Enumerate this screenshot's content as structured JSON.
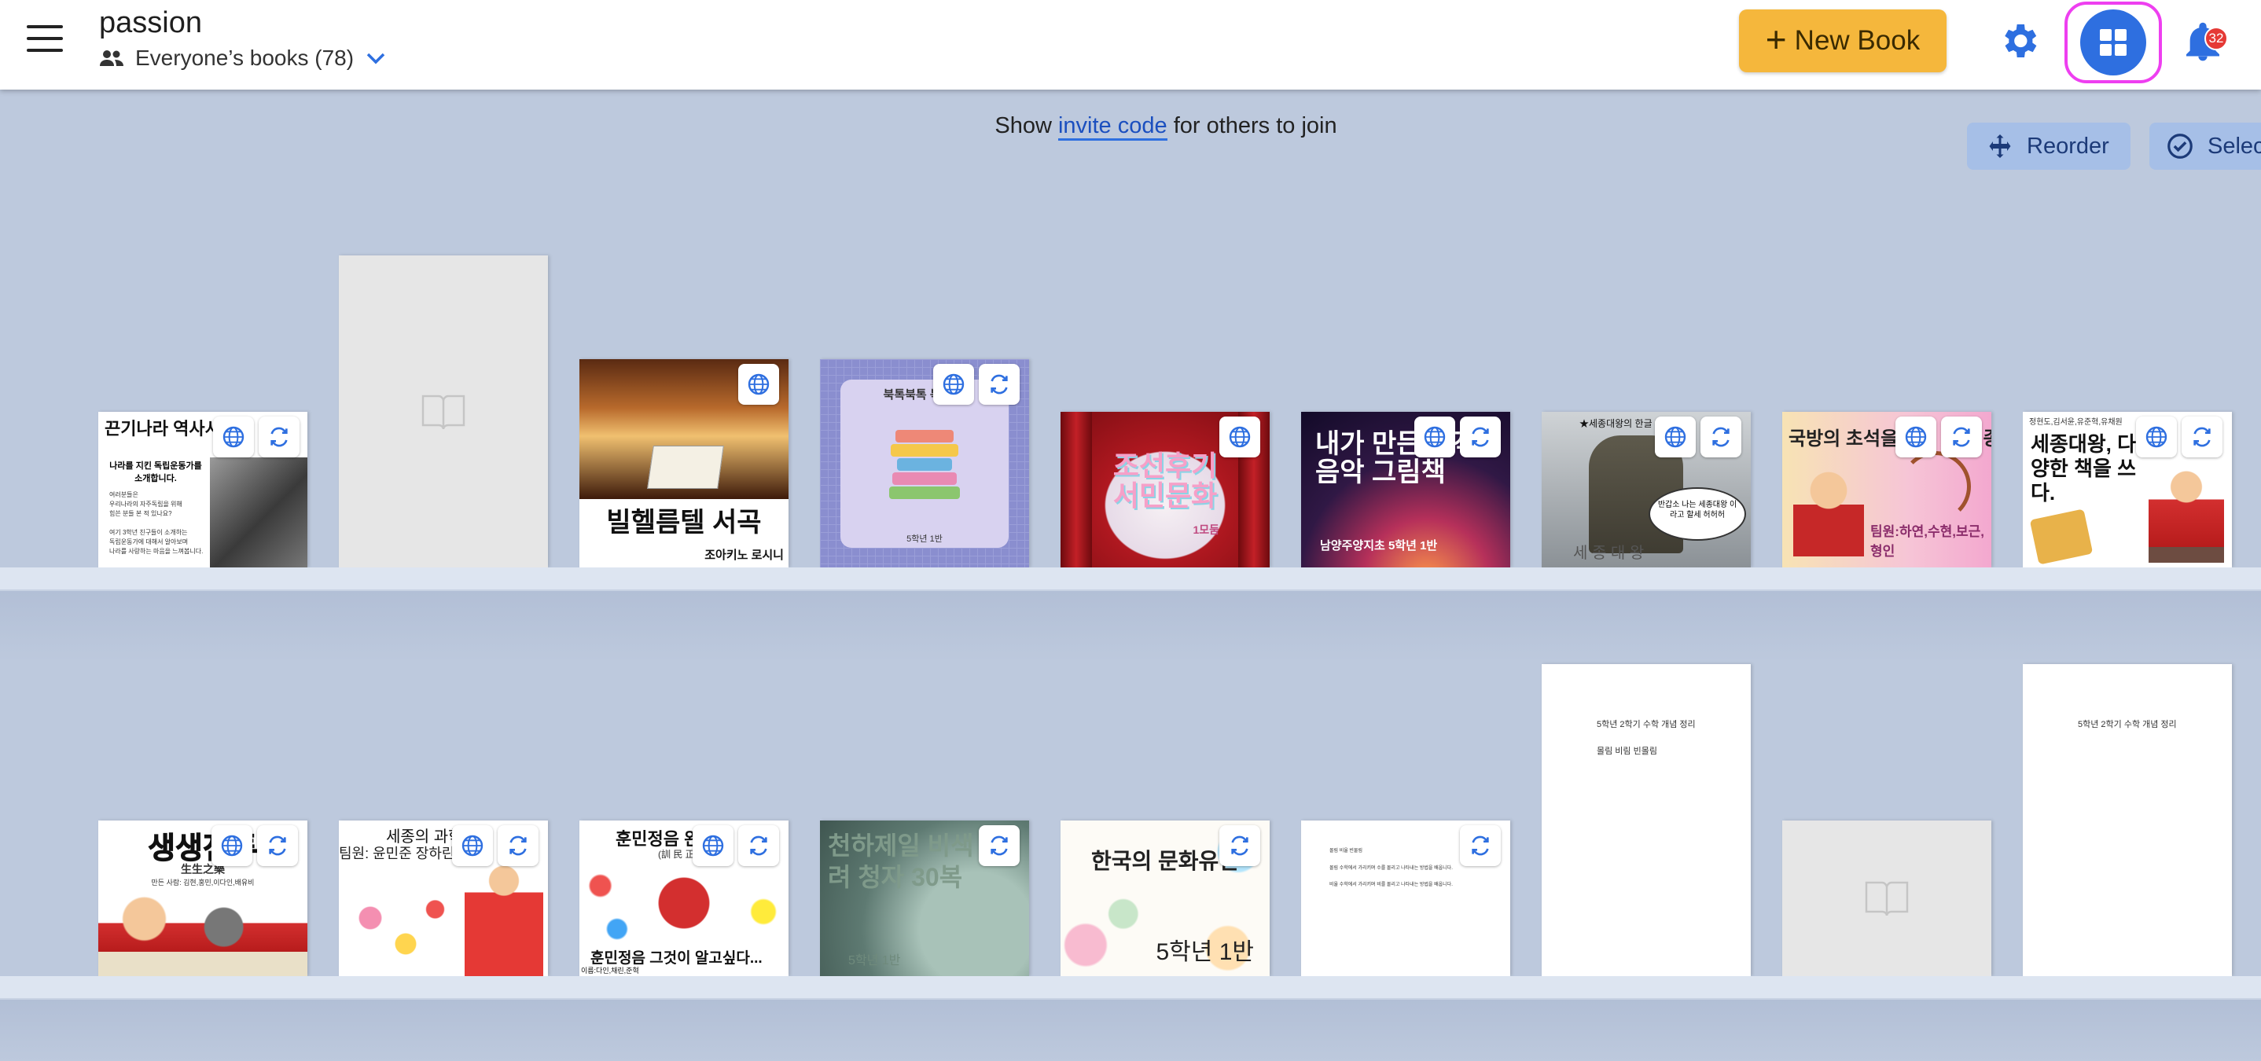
{
  "header": {
    "menu_icon": "hamburger-menu-icon",
    "title": "passion",
    "library_label": "Everyone’s books (78)",
    "new_book_label": "New Book",
    "notification_count": "32",
    "colors": {
      "new_book_bg": "#f5b73c",
      "accent": "#2e6fe0",
      "highlight": "#ee3ff0",
      "badge": "#e53935"
    }
  },
  "toolbar": {
    "invite_prefix": "Show",
    "invite_code": "invite code",
    "invite_suffix": "for others to join",
    "reorder_label": "Reorder",
    "select_label": "Select"
  },
  "shelf1": [
    {
      "title": "끈기나라 역사서",
      "subtitle": "나라를 지킨 독립운동가를 소개합니다.",
      "lines": [
        "여러분들은",
        "우리나라의 자주독립을 위해",
        "힘쓴 분들 본 적 있나요?",
        "",
        "여기 3학년 친구들이 소개하는",
        "독립운동가에 대해서 알아보며",
        "나라를 사랑하는 마음을 느껴봅니다."
      ],
      "badges": [
        "globe",
        "sync"
      ]
    },
    {
      "title": "",
      "badges": []
    },
    {
      "title": "빌헬름텔 서곡",
      "author": "조아키노 로시니",
      "badges": [
        "globe"
      ]
    },
    {
      "title": "북톡북톡 북 추천",
      "footer": "5학년 1반",
      "badges": [
        "globe",
        "sync"
      ]
    },
    {
      "title": "조선후기 서민문화",
      "footer": "1모둠",
      "badges": [
        "globe"
      ]
    },
    {
      "title": "내가 만든 창작음악 그림책",
      "footer": "남양주양지초 5학년 1반",
      "badges": [
        "globe",
        "sync"
      ]
    },
    {
      "title": "★세종대왕의 한글 창제",
      "bubble": "반갑소 나는 세종대왕 이라고 할세 허허허",
      "footer": "세 종 대 왕",
      "badges": [
        "globe",
        "sync"
      ]
    },
    {
      "title": "국방의 초석을 다진 왕 세종",
      "footer": "팀원:하연,수현,보근,형인",
      "badges": [
        "globe",
        "sync"
      ]
    },
    {
      "title": "세종대왕, 다양한 책을 쓰다.",
      "top": "정현도,김서윤,유준혁,유채원",
      "badges": [
        "globe",
        "sync"
      ]
    }
  ],
  "shelf2": [
    {
      "title": "생생전투",
      "subtitle": "生生之樂",
      "note": "만든 사람: 김현,홍민,이다인,배유비",
      "badges": [
        "globe",
        "sync"
      ]
    },
    {
      "title": "세종의 과학",
      "footer": "팀원: 윤민준 장하린",
      "badges": [
        "globe",
        "sync"
      ]
    },
    {
      "title": "훈민정음 완성",
      "subtitle": "(訓 民 正 音)",
      "footer": "훈민정음 그것이 알고싶다...",
      "note": "이름:다인,채린,준혁",
      "badges": [
        "globe",
        "sync"
      ]
    },
    {
      "title": "천하제일 비색 고려 청자 30복",
      "footer": "5학년 1반",
      "badges": [
        "sync"
      ]
    },
    {
      "title": "한국의 문화유산",
      "footer": "5학년 1반",
      "badges": [
        "sync"
      ]
    },
    {
      "title": "",
      "lines": [
        "몰림 비율 빈물림",
        "",
        "몰림 수학에서 가리키며 수를 몰리고 나타내는 방법을 배웁니다.",
        "",
        "비율 수학에서 가리키며 비를 몰리고 나타내는 방법을 배웁니다."
      ],
      "badges": [
        "sync"
      ]
    },
    {
      "title": "5학년 2학기 수학 개념 정리",
      "subtitle": "몰림 비림 빈몰림",
      "badges": []
    },
    {
      "title": "",
      "badges": []
    },
    {
      "title": "5학년 2학기 수학 개념 정리",
      "badges": []
    }
  ]
}
